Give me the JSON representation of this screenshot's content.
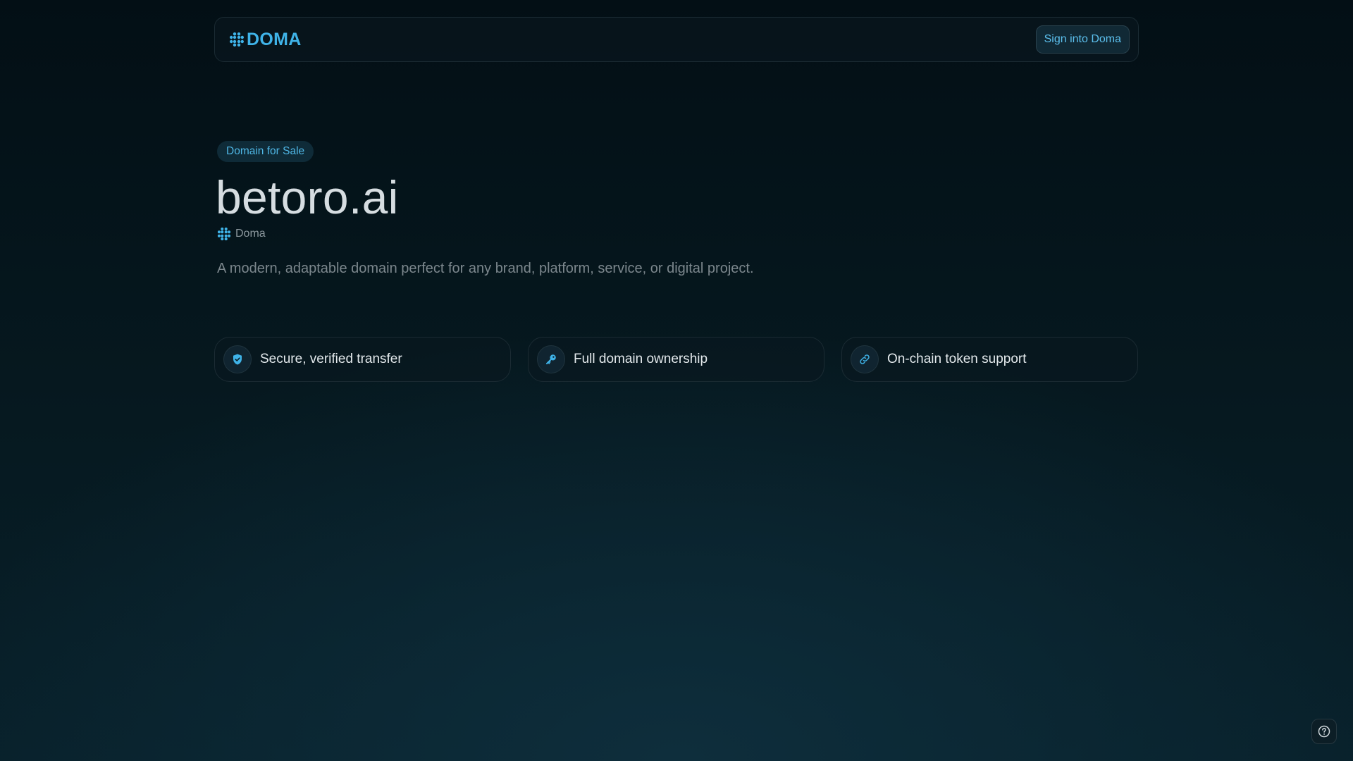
{
  "header": {
    "brand_name": "DOMA",
    "brand_icon": "doma-logo-icon",
    "signin_label": "Sign into Doma"
  },
  "hero": {
    "badge": "Domain for Sale",
    "domain": "betoro.ai",
    "provider": "Doma",
    "provider_icon": "doma-logo-icon",
    "description": "A modern, adaptable domain perfect for any brand, platform, service, or digital project."
  },
  "features": [
    {
      "label": "Secure, verified transfer",
      "icon": "shield-check-icon"
    },
    {
      "label": "Full domain ownership",
      "icon": "key-icon"
    },
    {
      "label": "On-chain token support",
      "icon": "link-icon"
    }
  ],
  "help": {
    "icon": "help-circle-icon"
  },
  "colors": {
    "accent": "#3fb3e8",
    "background": "#04121a",
    "text_primary": "#d6dde1",
    "text_muted": "#7c878d"
  }
}
